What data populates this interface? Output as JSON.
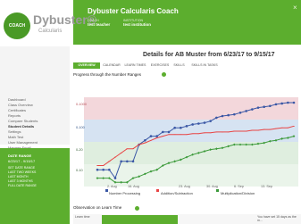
{
  "header": {
    "logo_badge": "COACH",
    "logo_text": "Dybuster®",
    "logo_sub": "Calcularis",
    "title": "Dybuster Calcularis Coach",
    "row_labels": [
      "COACH",
      "INSTITUTION"
    ],
    "row_values": [
      "test teacher",
      "test institution"
    ],
    "close_icon": "×"
  },
  "sidebar": {
    "items": [
      "Dashboard",
      "Class Overview",
      "Certificates",
      "Reports",
      "Compare Students",
      "Student Details",
      "Settings",
      "Math Test",
      "User Management",
      "Manage Email"
    ],
    "active_index": 5
  },
  "date_range": {
    "title": "DATE RANGE",
    "value": "6/23/17 - 9/15/17",
    "quick_links": [
      "SET DATE RANGE",
      "LAST TWO WEEKS",
      "LAST MONTH",
      "LAST 3 MONTHS",
      "FULL DATE RANGE"
    ]
  },
  "main": {
    "title": "Details for AB Muster from 6/23/17 to 9/15/17",
    "tabs": [
      "OVERVIEW",
      "CALENDAR",
      "LEARN TIMES",
      "EXERCISES",
      "SKILLS",
      "SKILLS IN TASKS"
    ],
    "active_tab_index": 0,
    "section_title": "Progress through the Number Ranges"
  },
  "chart_data": {
    "type": "line",
    "x": [
      "2. Aug",
      "16. Aug",
      "23. Aug",
      "30. Aug",
      "6. Sep",
      "13. Sep"
    ],
    "y_ticks": [
      "0-1000",
      "0-100",
      "0-20",
      "0-10"
    ],
    "series": [
      {
        "name": "Number Processing",
        "color": "#3a57a5",
        "values": [
          0.2,
          0.2,
          0.2,
          0.1,
          0.3,
          0.3,
          0.3,
          0.5,
          0.55,
          0.6,
          0.6,
          0.65,
          0.65,
          0.7,
          0.7,
          0.72,
          0.74,
          0.75,
          0.76,
          0.78,
          0.82,
          0.84,
          0.85,
          0.86,
          0.88,
          0.9,
          0.92,
          0.94,
          0.95,
          0.96,
          0.98,
          0.99,
          1,
          1
        ]
      },
      {
        "name": "Addition/Subtraction",
        "color": "#e84444",
        "values": [
          0.25,
          0.25,
          0.3,
          0.35,
          0.4,
          0.45,
          0.45,
          0.5,
          0.52,
          0.55,
          0.58,
          0.6,
          0.62,
          0.62,
          0.62,
          0.62,
          0.63,
          0.63,
          0.64,
          0.64,
          0.65,
          0.65,
          0.65,
          0.66,
          0.66,
          0.66,
          0.67,
          0.67,
          0.68,
          0.68,
          0.69,
          0.7,
          0.7,
          0.72
        ]
      },
      {
        "name": "Multiplication/Division",
        "color": "#3c9a3a",
        "values": [
          0.1,
          0.1,
          0.1,
          0.05,
          0.05,
          0.05,
          0.1,
          0.12,
          0.15,
          0.18,
          0.2,
          0.25,
          0.28,
          0.3,
          0.32,
          0.35,
          0.38,
          0.4,
          0.42,
          0.44,
          0.45,
          0.46,
          0.48,
          0.5,
          0.5,
          0.5,
          0.5,
          0.51,
          0.52,
          0.54,
          0.55,
          0.57,
          0.58,
          0.6
        ]
      }
    ]
  },
  "learn_time": {
    "title": "Observation on Learn Time",
    "bar_label": "Learn time",
    "note": "You have set 15 days as the m..."
  }
}
